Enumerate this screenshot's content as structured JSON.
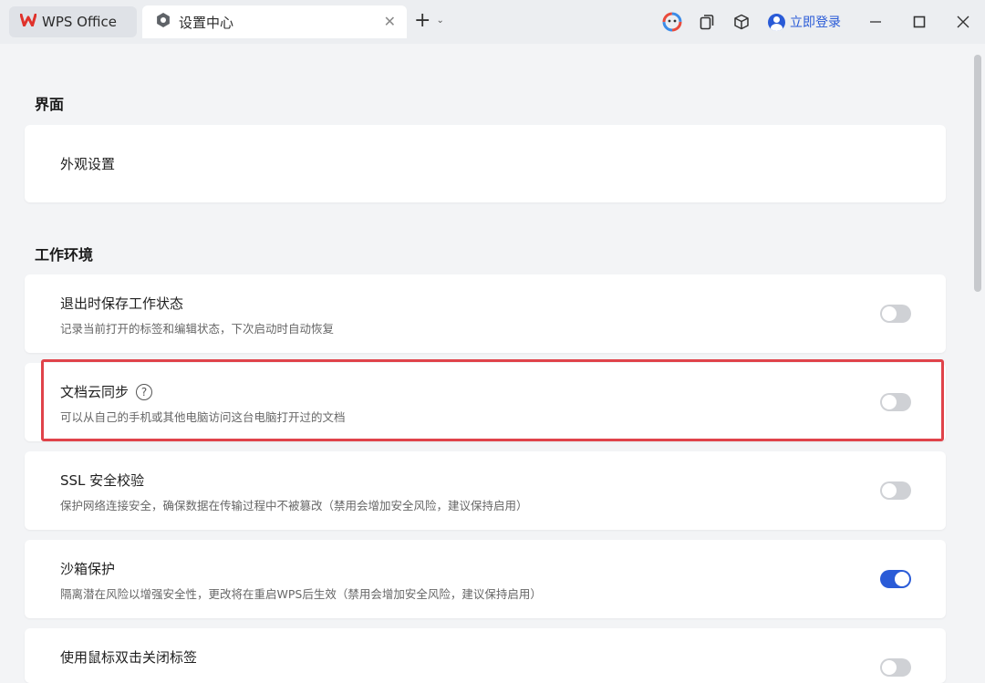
{
  "titlebar": {
    "home_tab_label": "WPS Office",
    "active_tab_label": "设置中心",
    "login_label": "立即登录"
  },
  "sections": [
    {
      "title": "界面"
    },
    {
      "title": "工作环境"
    }
  ],
  "settings": {
    "appearance": {
      "title": "外观设置"
    },
    "save_state": {
      "title": "退出时保存工作状态",
      "desc": "记录当前打开的标签和编辑状态，下次启动时自动恢复",
      "enabled": false
    },
    "cloud_sync": {
      "title": "文档云同步",
      "desc": "可以从自己的手机或其他电脑访问这台电脑打开过的文档",
      "enabled": false
    },
    "ssl_check": {
      "title": "SSL 安全校验",
      "desc": "保护网络连接安全，确保数据在传输过程中不被篡改（禁用会增加安全风险，建议保持启用）",
      "enabled": false
    },
    "sandbox": {
      "title": "沙箱保护",
      "desc": "隔离潜在风险以增强安全性，更改将在重启WPS后生效（禁用会增加安全风险，建议保持启用）",
      "enabled": true
    },
    "dblclick_close": {
      "title": "使用鼠标双击关闭标签",
      "enabled": false
    }
  },
  "colors": {
    "accent": "#2a5bd7",
    "highlight_border": "#e0434a",
    "wps_red": "#e0322b"
  }
}
